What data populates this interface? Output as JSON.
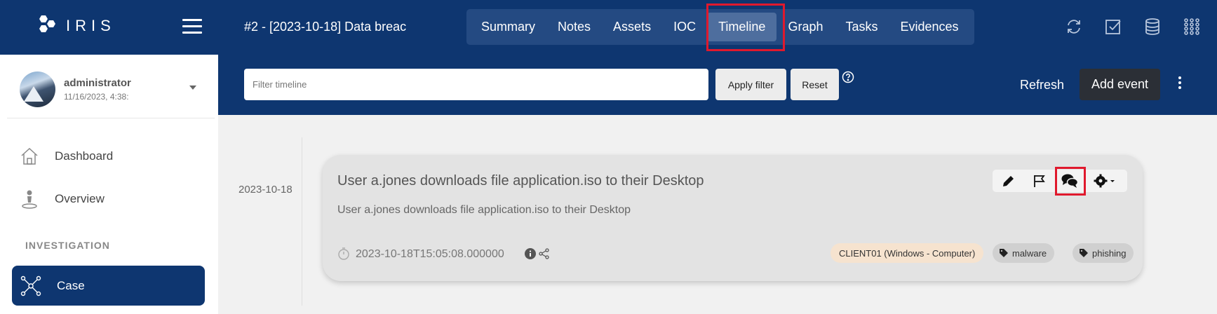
{
  "app": {
    "logo_text": "IRIS"
  },
  "header": {
    "case_title": "#2 - [2023-10-18] Data breac",
    "tabs": [
      {
        "label": "Summary"
      },
      {
        "label": "Notes"
      },
      {
        "label": "Assets"
      },
      {
        "label": "IOC"
      },
      {
        "label": "Timeline",
        "active": true
      },
      {
        "label": "Graph"
      },
      {
        "label": "Tasks"
      },
      {
        "label": "Evidences"
      }
    ],
    "icons": [
      "sync-icon",
      "tasks-check-icon",
      "database-icon",
      "apps-grid-icon"
    ]
  },
  "sidebar": {
    "user": {
      "name": "administrator",
      "date": "11/16/2023, 4:38:"
    },
    "items": [
      {
        "label": "Dashboard",
        "icon": "home-icon"
      },
      {
        "label": "Overview",
        "icon": "map-marker-icon"
      }
    ],
    "section": "INVESTIGATION",
    "active_item": {
      "label": "Case",
      "icon": "network-icon"
    }
  },
  "filter": {
    "placeholder": "Filter timeline",
    "apply_label": "Apply filter",
    "reset_label": "Reset",
    "refresh_label": "Refresh",
    "add_event_label": "Add event"
  },
  "timeline": {
    "date": "2023-10-18",
    "event": {
      "title": "User a.jones downloads file application.iso to their Desktop",
      "description": "User a.jones downloads file application.iso to their Desktop",
      "timestamp": "2023-10-18T15:05:08.000000",
      "asset": "CLIENT01 (Windows - Computer)",
      "tags": [
        "malware",
        "phishing"
      ]
    }
  },
  "colors": {
    "brand": "#0e3670",
    "highlight": "#e0192d",
    "asset_badge": "#f6e3cf"
  }
}
